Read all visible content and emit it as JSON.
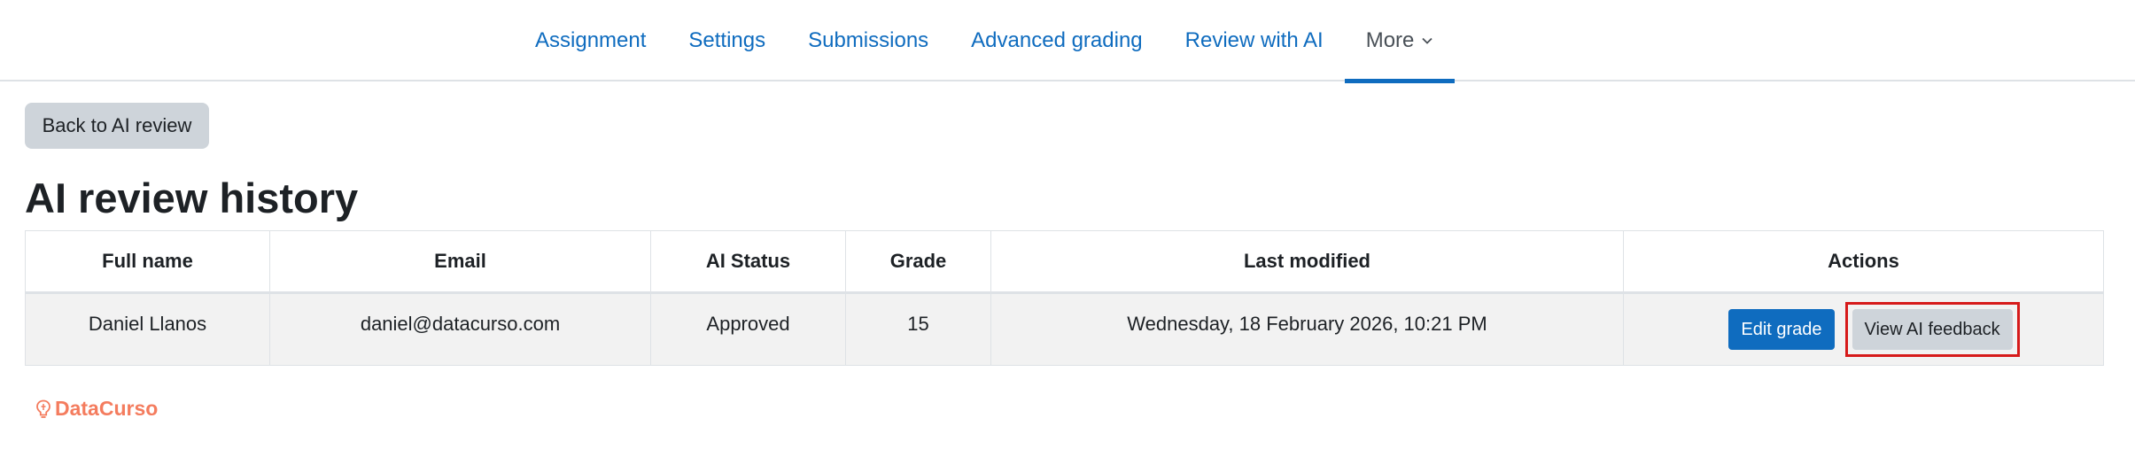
{
  "nav": {
    "items": [
      {
        "label": "Assignment"
      },
      {
        "label": "Settings"
      },
      {
        "label": "Submissions"
      },
      {
        "label": "Advanced grading"
      },
      {
        "label": "Review with AI"
      },
      {
        "label": "More"
      }
    ],
    "active_icon": "chevron-down-icon"
  },
  "back_button": {
    "label": "Back to AI review"
  },
  "page_title": "AI review history",
  "table": {
    "headers": [
      "Full name",
      "Email",
      "AI Status",
      "Grade",
      "Last modified",
      "Actions"
    ],
    "rows": [
      {
        "full_name": "Daniel Llanos",
        "email": "daniel@datacurso.com",
        "ai_status": "Approved",
        "grade": "15",
        "last_modified": "Wednesday, 18 February 2026, 10:21 PM",
        "actions": {
          "edit_label": "Edit grade",
          "view_label": "View AI feedback"
        }
      }
    ]
  },
  "footer": {
    "brand": "DataCurso",
    "icon": "datacurso-logo-icon"
  },
  "colors": {
    "link": "#0f6cbf",
    "primary_button": "#0f6cbf",
    "secondary_button": "#ced4da",
    "highlight": "#d61a1a",
    "brand": "#f47c5e"
  }
}
